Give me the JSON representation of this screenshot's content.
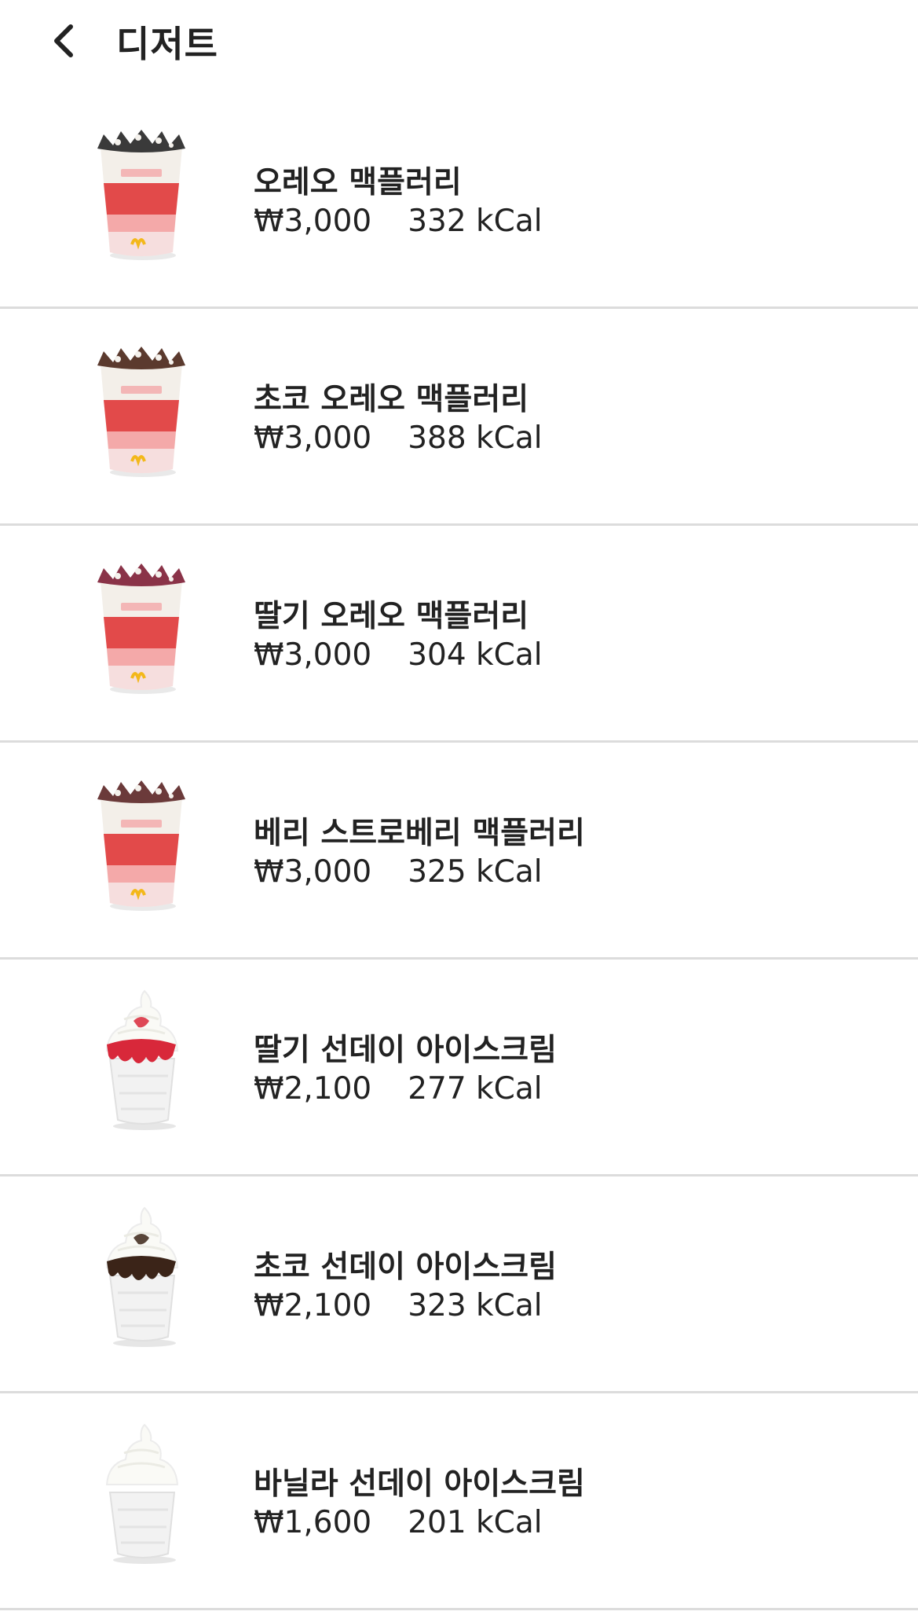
{
  "header": {
    "title": "디저트",
    "back_icon": "chevron-left-icon"
  },
  "items": [
    {
      "name": "오레오 맥플러리",
      "price": "₩3,000",
      "kcal": "332 kCal",
      "image": "mcflurry-cup",
      "topping": "#3a3a3a"
    },
    {
      "name": "초코 오레오 맥플러리",
      "price": "₩3,000",
      "kcal": "388 kCal",
      "image": "mcflurry-cup",
      "topping": "#5b3a2e"
    },
    {
      "name": "딸기 오레오 맥플러리",
      "price": "₩3,000",
      "kcal": "304 kCal",
      "image": "mcflurry-cup",
      "topping": "#8a3348"
    },
    {
      "name": "베리 스트로베리 맥플러리",
      "price": "₩3,000",
      "kcal": "325 kCal",
      "image": "mcflurry-cup",
      "topping": "#6b3a3a"
    },
    {
      "name": "딸기 선데이 아이스크림",
      "price": "₩2,100",
      "kcal": "277 kCal",
      "image": "sundae-cup",
      "topping": "#d8283a"
    },
    {
      "name": "초코 선데이 아이스크림",
      "price": "₩2,100",
      "kcal": "323 kCal",
      "image": "sundae-cup",
      "topping": "#3b2418"
    },
    {
      "name": "바닐라 선데이 아이스크림",
      "price": "₩1,600",
      "kcal": "201 kCal",
      "image": "sundae-cup",
      "topping": "#f7f5f0"
    }
  ],
  "colors": {
    "cup_red": "#e24a4a",
    "cup_pink": "#f4a9a9",
    "cup_white": "#f3efe9",
    "divider": "#dcdcdc",
    "logo_yellow": "#f3b81a"
  }
}
